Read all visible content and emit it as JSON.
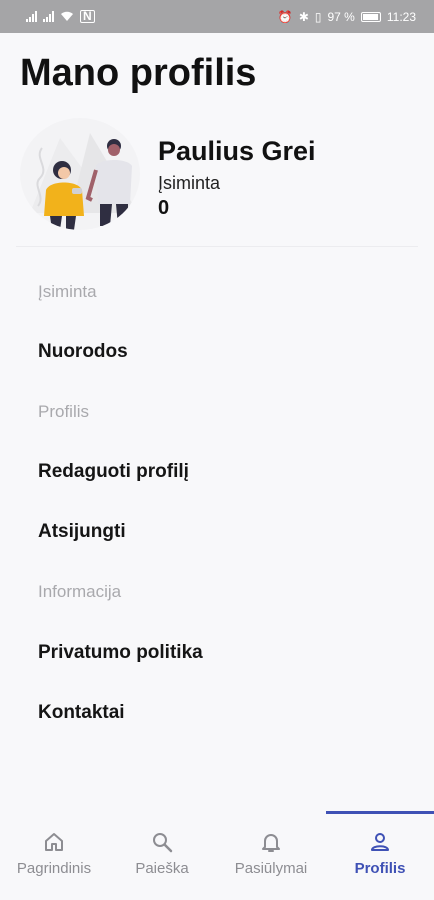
{
  "status_bar": {
    "battery_percent": "97 %",
    "time": "11:23",
    "nfc_label": "N"
  },
  "page_title": "Mano profilis",
  "profile": {
    "name": "Paulius Grei",
    "saved_label": "Įsiminta",
    "saved_count": "0"
  },
  "menu": {
    "section_saved": "Įsiminta",
    "links": "Nuorodos",
    "section_profile": "Profilis",
    "edit_profile": "Redaguoti profilį",
    "logout": "Atsijungti",
    "section_info": "Informacija",
    "privacy_policy": "Privatumo politika",
    "contacts": "Kontaktai"
  },
  "tabs": [
    {
      "label": "Pagrindinis",
      "icon": "home-icon",
      "active": false
    },
    {
      "label": "Paieška",
      "icon": "search-icon",
      "active": false
    },
    {
      "label": "Pasiūlymai",
      "icon": "bell-icon",
      "active": false
    },
    {
      "label": "Profilis",
      "icon": "person-icon",
      "active": true
    }
  ],
  "colors": {
    "accent": "#3f51b5",
    "status_bar": "#a5a5a7",
    "section_text": "#a9a9ad",
    "background": "#f8f8fa"
  }
}
